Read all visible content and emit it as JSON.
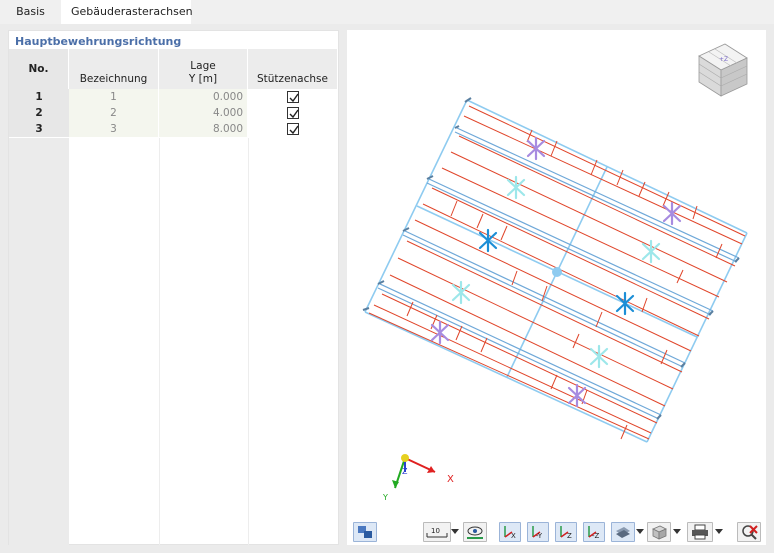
{
  "tabs": [
    {
      "label": "Basis"
    },
    {
      "label": "Gebäuderasterachsen"
    }
  ],
  "table": {
    "title": "Hauptbewehrungsrichtung",
    "columns": {
      "no": "No.",
      "bezeichnung": "Bezeichnung",
      "lage_line1": "Lage",
      "lage_line2": "Y [m]",
      "stuetzenachse": "Stützenachse"
    },
    "rows": [
      {
        "no": "1",
        "bezeichnung": "1",
        "y": "0.000",
        "stuetzenachse": true
      },
      {
        "no": "2",
        "bezeichnung": "2",
        "y": "4.000",
        "stuetzenachse": true
      },
      {
        "no": "3",
        "bezeichnung": "3",
        "y": "8.000",
        "stuetzenachse": true
      }
    ]
  },
  "viewport": {
    "view_cube_label": "+Z",
    "axes": {
      "x": "X",
      "y": "Y",
      "z": "Z"
    }
  },
  "toolbar": {
    "scale_label": "10",
    "buttons": [
      {
        "icon": "view-options-icon"
      },
      {
        "icon": "scale-dropdown-icon"
      },
      {
        "icon": "visibility-icon"
      },
      {
        "icon": "view-x-icon",
        "label": "X"
      },
      {
        "icon": "view-minus-y-icon",
        "label": "-Y"
      },
      {
        "icon": "view-z-icon",
        "label": "Z"
      },
      {
        "icon": "view-minus-z-icon",
        "label": "-Z"
      },
      {
        "icon": "render-mode-icon"
      },
      {
        "icon": "box-view-icon"
      },
      {
        "icon": "print-icon"
      },
      {
        "icon": "reset-icon"
      }
    ]
  },
  "colors": {
    "grid_line": "#8ecbf0",
    "rebar_line": "#e0452a",
    "column_marker_purple": "#a78be0",
    "column_marker_cyan": "#9de7ea",
    "column_marker_blue": "#1c8ed6",
    "title_blue": "#4b6fa8"
  }
}
